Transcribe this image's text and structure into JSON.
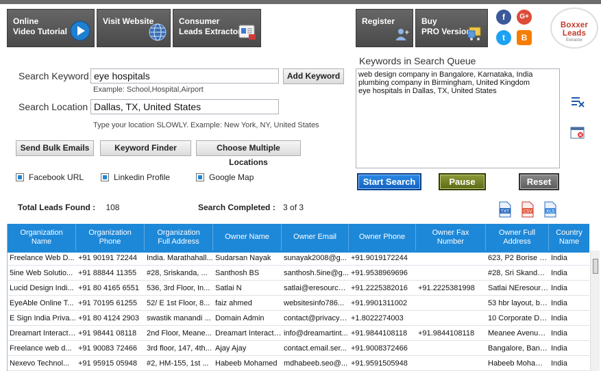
{
  "toolbar": {
    "video_tutorial": "Online\nVideo Tutorial",
    "visit_website": "Visit Website",
    "leads_extractor": "Consumer\nLeads Extractor",
    "register": "Register",
    "buy_pro": "Buy\nPRO Version"
  },
  "social": {
    "facebook": "f",
    "google_plus": "G+",
    "twitter": "t",
    "blogger": "B"
  },
  "logo": {
    "title": "Boxxer Leads",
    "subtitle": "Extractor"
  },
  "form": {
    "keyword_label": "Search Keyword",
    "keyword_value": "eye hospitals",
    "add_keyword": "Add Keyword",
    "keyword_hint": "Example: School,Hospital,Airport",
    "location_label": "Search Location",
    "location_value": "Dallas, TX, United States",
    "location_hint": "Type your location SLOWLY. Example: New York, NY, United States",
    "send_bulk_emails": "Send Bulk Emails",
    "keyword_finder": "Keyword Finder",
    "choose_locations": "Choose Multiple Locations",
    "facebook_url": "Facebook URL",
    "linkedin_profile": "Linkedin Profile",
    "google_map": "Google Map"
  },
  "queue": {
    "title": "Keywords in Search Queue",
    "items": [
      "web design company in Bangalore, Karnataka, India",
      "plumbing company in Birmingham, United Kingdom",
      "eye hospitals in Dallas, TX, United States"
    ]
  },
  "actions": {
    "start": "Start Search",
    "pause": "Pause",
    "reset": "Reset"
  },
  "stats": {
    "total_label": "Total Leads Found :",
    "total_value": "108",
    "completed_label": "Search Completed :",
    "completed_value": "3 of 3"
  },
  "files": {
    "txt": "TXT",
    "csv": "CSV",
    "xls": "XLS"
  },
  "table": {
    "columns": [
      "Organization\nName",
      "Organization\nPhone",
      "Organization\nFull Address",
      "Owner Name",
      "Owner Email",
      "Owner Phone",
      "Owner Fax\nNumber",
      "Owner Full\nAddress",
      "Country\nName"
    ],
    "rows": [
      [
        "Freelance Web D...",
        "+91 90191 72244",
        "India. Marathahall...",
        "Sudarsan Nayak",
        "sunayak2008@g...",
        "+91.9019172244",
        "",
        "623, P2 Borise C...",
        "India"
      ],
      [
        "5ine Web Solutio...",
        "+91 88844 11355",
        "#28, Sriskanda, ...",
        "Santhosh BS",
        "santhosh.5ine@g...",
        "+91.9538969696",
        "",
        "#28, Sri Skanda, ...",
        "India"
      ],
      [
        "Lucid Design Indi...",
        "+91 80 4165 6551",
        "536, 3rd Floor, In...",
        "Satlai N",
        "satlai@eresourcei...",
        "+91.2225382016",
        "+91.2225381998",
        "Satlai NEresourc...",
        "India"
      ],
      [
        "EyeAble Online T...",
        "+91 70195 61255",
        "52/ E 1st Floor, 8...",
        "faiz ahmed",
        "websitesinfo786...",
        "+91.9901311002",
        "",
        "53 hbr layout, ba...",
        "India"
      ],
      [
        "E Sign India Priva...",
        "+91 80 4124 2903",
        "swastik manandi ...",
        "Domain Admin",
        "contact@privacyv...",
        "+1.8022274003",
        "",
        "10 Corporate Driv...",
        "India"
      ],
      [
        "Dreamart Interacti...",
        "+91 98441 08118",
        "2nd Floor, Meane...",
        "Dreamart Interacti...",
        "info@dreamartint...",
        "+91.9844108118",
        "+91.9844108118",
        "Meanee Avenue ...",
        "India"
      ],
      [
        "Freelance web d...",
        "+91 90083 72466",
        "3rd floor, 147, 4th...",
        "Ajay Ajay",
        "contact.email.ser...",
        "+91.9008372466",
        "",
        "Bangalore, Banga...",
        "India"
      ],
      [
        "Nexevo Technol...",
        "+91 95915 05948",
        "#2, HM-155, 1st ...",
        "Habeeb Mohamed",
        "mdhabeeb.seo@...",
        "+91.9591505948",
        "",
        "Habeeb Mohamed...",
        "India"
      ]
    ]
  }
}
